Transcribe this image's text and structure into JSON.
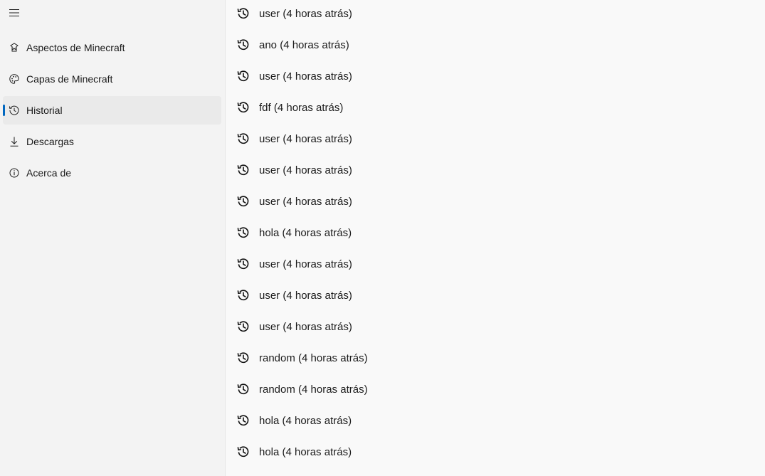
{
  "sidebar": {
    "menu_icon": "hamburger-menu-icon",
    "items": [
      {
        "label": "Aspectos de Minecraft",
        "icon": "skin-icon",
        "selected": false
      },
      {
        "label": "Capas de Minecraft",
        "icon": "palette-icon",
        "selected": false
      },
      {
        "label": "Historial",
        "icon": "history-icon",
        "selected": true
      },
      {
        "label": "Descargas",
        "icon": "download-icon",
        "selected": false
      },
      {
        "label": "Acerca de",
        "icon": "info-icon",
        "selected": false
      }
    ],
    "accent_color": "#0067c0"
  },
  "history": {
    "icon": "history-icon",
    "items": [
      {
        "text": "user (4 horas atrás)"
      },
      {
        "text": "ano (4 horas atrás)"
      },
      {
        "text": "user (4 horas atrás)"
      },
      {
        "text": "fdf (4 horas atrás)"
      },
      {
        "text": "user (4 horas atrás)"
      },
      {
        "text": "user (4 horas atrás)"
      },
      {
        "text": "user (4 horas atrás)"
      },
      {
        "text": "hola (4 horas atrás)"
      },
      {
        "text": "user (4 horas atrás)"
      },
      {
        "text": "user (4 horas atrás)"
      },
      {
        "text": "user (4 horas atrás)"
      },
      {
        "text": "random (4 horas atrás)"
      },
      {
        "text": "random (4 horas atrás)"
      },
      {
        "text": "hola (4 horas atrás)"
      },
      {
        "text": "hola (4 horas atrás)"
      }
    ]
  }
}
